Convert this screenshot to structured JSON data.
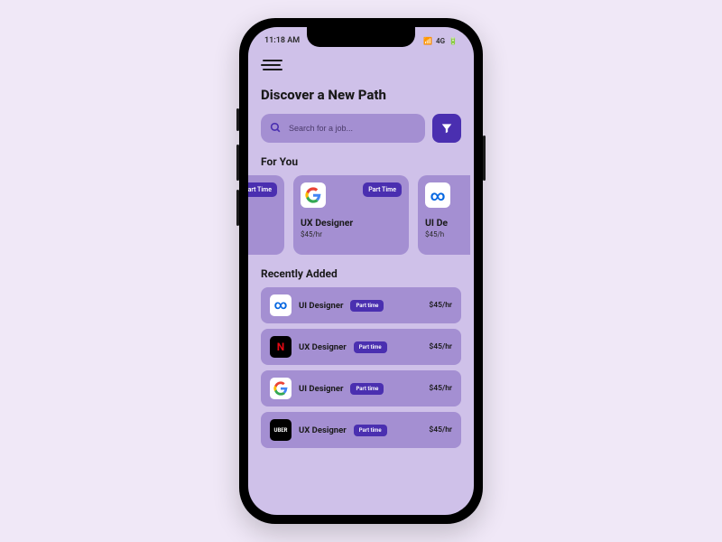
{
  "statusbar": {
    "time": "11:18 AM",
    "signal": "4G"
  },
  "header": {
    "title": "Discover a New Path"
  },
  "search": {
    "placeholder": "Search for a job..."
  },
  "sections": {
    "for_you": {
      "title": "For You",
      "cards": [
        {
          "badge": "Part Time"
        },
        {
          "company_icon": "google",
          "badge": "Part Time",
          "title": "UX Designer",
          "rate": "$45/hr"
        },
        {
          "company_icon": "meta",
          "title_peek": "UI De",
          "rate_peek": "$45/h"
        }
      ]
    },
    "recent": {
      "title": "Recently Added",
      "items": [
        {
          "company_icon": "meta",
          "title": "UI Designer",
          "badge": "Part time",
          "rate": "$45/hr"
        },
        {
          "company_icon": "netflix",
          "title": "UX Designer",
          "badge": "Part time",
          "rate": "$45/hr"
        },
        {
          "company_icon": "google",
          "title": "UI Designer",
          "badge": "Part time",
          "rate": "$45/hr"
        },
        {
          "company_icon": "uber",
          "title": "UX Designer",
          "badge": "Part time",
          "rate": "$45/hr"
        }
      ]
    }
  },
  "colors": {
    "accent": "#4a2fb0",
    "card": "#a48fd2",
    "screen_bg": "#cfc1e9"
  }
}
